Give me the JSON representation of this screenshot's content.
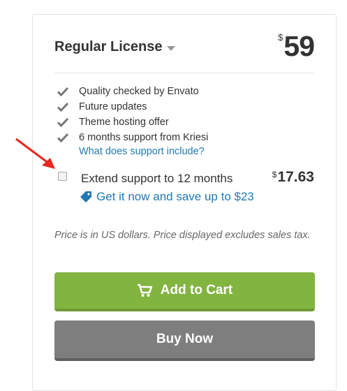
{
  "license": {
    "title": "Regular License",
    "currency": "$",
    "price": "59"
  },
  "features": [
    "Quality checked by Envato",
    "Future updates",
    "Theme hosting offer",
    "6 months support from Kriesi"
  ],
  "support_link": "What does support include?",
  "extend": {
    "label": "Extend support to 12 months",
    "currency": "$",
    "price": "17.63",
    "checked": false
  },
  "save_link": "Get it now and save up to $23",
  "note": "Price is in US dollars. Price displayed excludes sales tax.",
  "buttons": {
    "add_to_cart": "Add to Cart",
    "buy_now": "Buy Now"
  },
  "colors": {
    "accent_green": "#82b440",
    "link_blue": "#1f79b4",
    "buy_gray": "#7e7e7e",
    "arrow_red": "#e8281e"
  }
}
